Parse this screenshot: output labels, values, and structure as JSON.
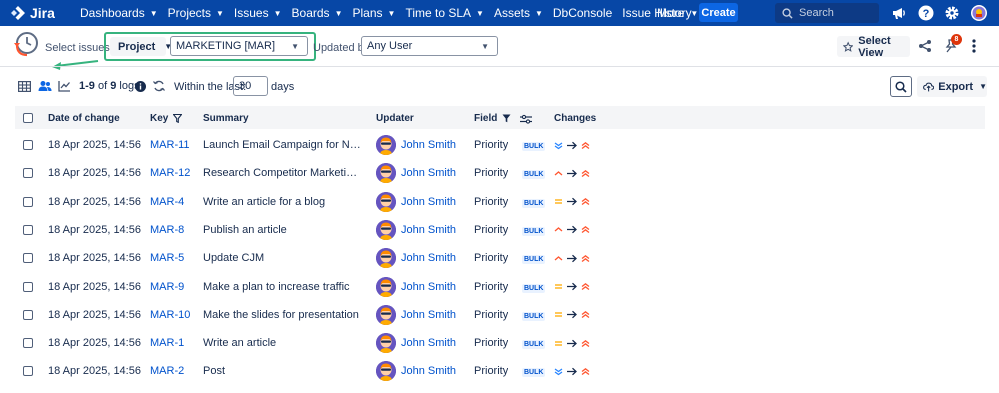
{
  "nav": {
    "logo": "Jira",
    "items": [
      {
        "label": "Dashboards",
        "chevron": true
      },
      {
        "label": "Projects",
        "chevron": true
      },
      {
        "label": "Issues",
        "chevron": true
      },
      {
        "label": "Boards",
        "chevron": true
      },
      {
        "label": "Plans",
        "chevron": true
      },
      {
        "label": "Time to SLA",
        "chevron": true
      },
      {
        "label": "Assets",
        "chevron": true
      },
      {
        "label": "DbConsole",
        "chevron": false
      },
      {
        "label": "Issue History",
        "chevron": false
      }
    ],
    "more": "More",
    "create": "Create",
    "search_placeholder": "Search"
  },
  "toolbar": {
    "select_issues_by": "Select issues by:",
    "project_button": "Project",
    "project_value": "MARKETING [MAR]",
    "updated_by_label": "Updated by:",
    "updated_by_value": "Any User",
    "select_view": "Select View",
    "notification_count": "8"
  },
  "subbar": {
    "range": "1-9",
    "of": "of",
    "total": "9",
    "logs": "logs",
    "within_label": "Within the last:",
    "days_value": "30",
    "days": "days",
    "export": "Export"
  },
  "table": {
    "headers": {
      "date": "Date of change",
      "key": "Key",
      "summary": "Summary",
      "updater": "Updater",
      "field": "Field",
      "changes": "Changes"
    },
    "bulk_label": "BULK",
    "rows": [
      {
        "date": "18 Apr 2025, 14:56",
        "key": "MAR-11",
        "summary": "Launch Email Campaign for New Leads",
        "updater": "John Smith",
        "field": "Priority",
        "from_priority": "lowest"
      },
      {
        "date": "18 Apr 2025, 14:56",
        "key": "MAR-12",
        "summary": "Research Competitor Marketing Strategies",
        "updater": "John Smith",
        "field": "Priority",
        "from_priority": "high"
      },
      {
        "date": "18 Apr 2025, 14:56",
        "key": "MAR-4",
        "summary": "Write an article for a blog",
        "updater": "John Smith",
        "field": "Priority",
        "from_priority": "medium"
      },
      {
        "date": "18 Apr 2025, 14:56",
        "key": "MAR-8",
        "summary": "Publish an article",
        "updater": "John Smith",
        "field": "Priority",
        "from_priority": "high"
      },
      {
        "date": "18 Apr 2025, 14:56",
        "key": "MAR-5",
        "summary": "Update CJM",
        "updater": "John Smith",
        "field": "Priority",
        "from_priority": "high"
      },
      {
        "date": "18 Apr 2025, 14:56",
        "key": "MAR-9",
        "summary": "Make a plan to increase traffic",
        "updater": "John Smith",
        "field": "Priority",
        "from_priority": "medium"
      },
      {
        "date": "18 Apr 2025, 14:56",
        "key": "MAR-10",
        "summary": "Make the slides for presentation",
        "updater": "John Smith",
        "field": "Priority",
        "from_priority": "medium"
      },
      {
        "date": "18 Apr 2025, 14:56",
        "key": "MAR-1",
        "summary": "Write an article",
        "updater": "John Smith",
        "field": "Priority",
        "from_priority": "medium"
      },
      {
        "date": "18 Apr 2025, 14:56",
        "key": "MAR-2",
        "summary": "Post",
        "updater": "John Smith",
        "field": "Priority",
        "from_priority": "lowest"
      }
    ],
    "to_priority": "highest"
  },
  "colors": {
    "nav_bg": "#0747a6",
    "link": "#0052cc",
    "highlight": "#36b37e",
    "priority_lowest": "#2684ff",
    "priority_medium": "#ffab00",
    "priority_high": "#ff5630",
    "priority_highest": "#ff5630"
  }
}
